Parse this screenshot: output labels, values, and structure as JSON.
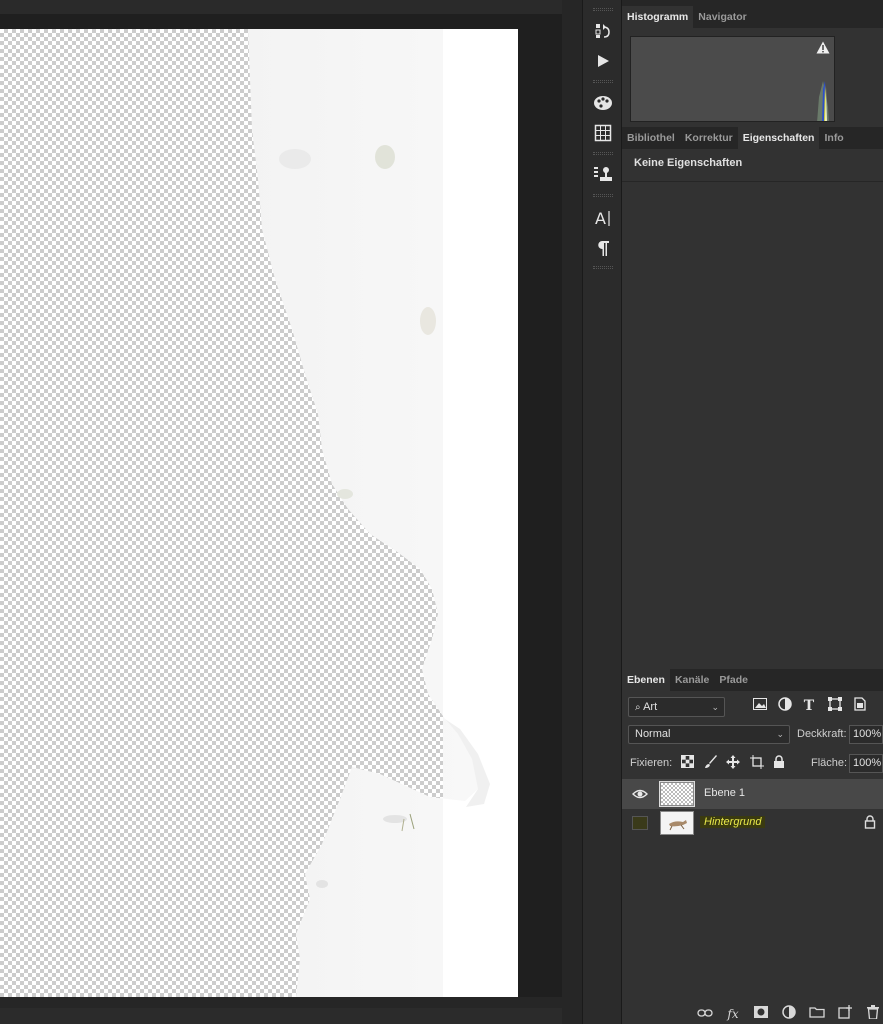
{
  "histogram_panel": {
    "tabs": [
      "Histogramm",
      "Navigator"
    ],
    "active_tab": "Histogramm"
  },
  "properties_panel": {
    "tabs": [
      "Bibliothel",
      "Korrektur",
      "Eigenschaften",
      "Info"
    ],
    "active_tab": "Eigenschaften",
    "message": "Keine Eigenschaften"
  },
  "layers_panel": {
    "tabs": [
      "Ebenen",
      "Kanäle",
      "Pfade"
    ],
    "active_tab": "Ebenen",
    "filter_kind": "Art",
    "blend_mode": "Normal",
    "opacity_label": "Deckkraft:",
    "opacity_value": "100%",
    "lock_label": "Fixieren:",
    "fill_label": "Fläche:",
    "fill_value": "100%",
    "layers": [
      {
        "name": "Ebene 1",
        "visible": true,
        "selected": true,
        "locked": false
      },
      {
        "name": "Hintergrund",
        "visible": false,
        "selected": false,
        "locked": true
      }
    ]
  },
  "tool_strip": {
    "icons": [
      "history-icon",
      "play-actions-icon",
      "swatches-icon",
      "grid-icon",
      "clone-source-icon",
      "character-icon",
      "paragraph-icon"
    ]
  },
  "footer_icons": [
    "link-layers-icon",
    "fx-icon",
    "add-mask-icon",
    "adjustment-layer-icon",
    "new-group-icon",
    "new-layer-icon",
    "delete-layer-icon"
  ],
  "colors": {
    "panel_bg": "#323232",
    "tab_bar_bg": "#262626",
    "selected_layer": "#484848",
    "highlight_text": "#e8e84a"
  }
}
